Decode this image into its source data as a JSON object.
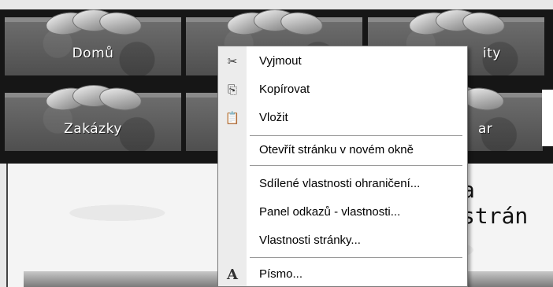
{
  "nav": {
    "row1": [
      "Domů",
      "",
      "ity"
    ],
    "row2": [
      "Zakázky",
      "",
      "ar"
    ]
  },
  "page": {
    "heading_fragment": "a strán"
  },
  "context_menu": {
    "items": [
      {
        "label": "Vyjmout",
        "icon": "scissors-icon",
        "glyph": "✂"
      },
      {
        "label": "Kopírovat",
        "icon": "copy-icon",
        "glyph": "⎘"
      },
      {
        "label": "Vložit",
        "icon": "paste-icon",
        "glyph": "📋"
      },
      {
        "label": "Otevřít stránku v novém okně",
        "icon": "",
        "glyph": ""
      },
      {
        "label": "Sdílené vlastnosti ohraničení...",
        "icon": "",
        "glyph": ""
      },
      {
        "label": "Panel odkazů - vlastnosti...",
        "icon": "",
        "glyph": ""
      },
      {
        "label": "Vlastnosti stránky...",
        "icon": "",
        "glyph": ""
      },
      {
        "label": "Písmo...",
        "icon": "font-icon",
        "glyph": "A"
      }
    ]
  }
}
